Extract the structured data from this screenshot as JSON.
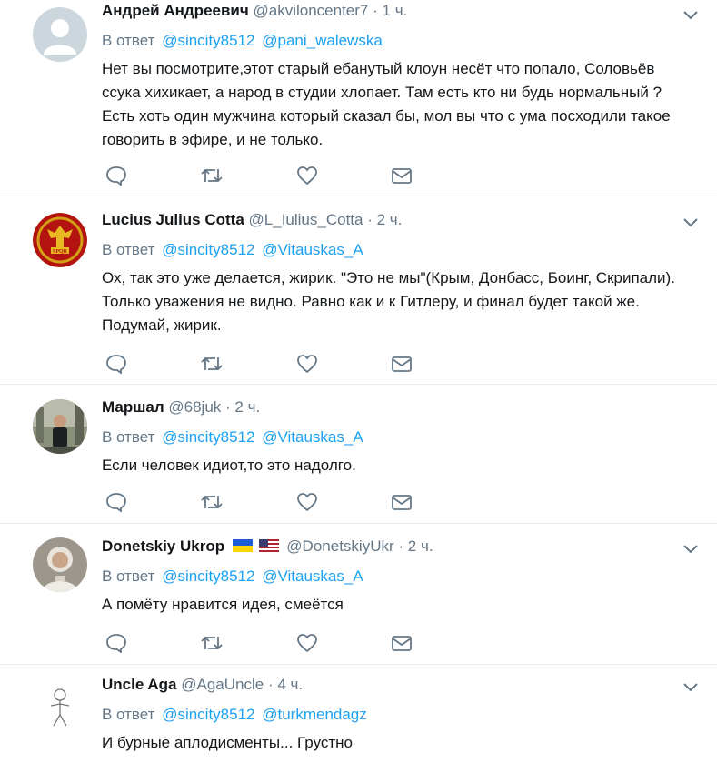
{
  "in_reply_prefix": "В ответ",
  "tweets": [
    {
      "name": "Андрей Андреевич",
      "handle": "@akviloncenter7",
      "dot": "·",
      "time": "1 ч.",
      "mentions": [
        "@sincity8512",
        "@pani_walewska"
      ],
      "text": "Нет вы посмотрите,этот старый ебанутый клоун несёт что попало, Соловьёв ссука хихикает, а народ в  студии хлопает. Там есть кто ни будь нормальный ? Есть хоть один мужчина который сказал бы, мол вы что с ума посходили такое говорить в эфире, и не только."
    },
    {
      "name": "Lucius Julius Cotta",
      "handle": "@L_Iulius_Cotta",
      "dot": "·",
      "time": "2 ч.",
      "mentions": [
        "@sincity8512",
        "@Vitauskas_A"
      ],
      "text": "Ох, так это уже делается, жирик. \"Это не мы\"(Крым, Донбасс, Боинг, Скрипали). Только уважения не видно. Равно как и к Гитлеру, и финал будет такой же. Подумай, жирик.",
      "avatar_text": "SPQR"
    },
    {
      "name": "Маршал",
      "handle": "@68juk",
      "dot": "·",
      "time": "2 ч.",
      "mentions": [
        "@sincity8512",
        "@Vitauskas_A"
      ],
      "text": "Если человек идиот,то это надолго."
    },
    {
      "name": "Donetskiy Ukrop",
      "handle": "@DonetskiyUkr",
      "dot": "·",
      "time": "2 ч.",
      "mentions": [
        "@sincity8512",
        "@Vitauskas_A"
      ],
      "text": "А помёту нравится идея, смеётся"
    },
    {
      "name": "Uncle Aga",
      "handle": "@AgaUncle",
      "dot": "·",
      "time": "4 ч.",
      "mentions": [
        "@sincity8512",
        "@turkmendagz"
      ],
      "text": "И бурные аплодисменты... Грустно"
    }
  ],
  "icons": {
    "reply": "reply-icon",
    "retweet": "retweet-icon",
    "like": "heart-icon",
    "dm": "envelope-icon",
    "menu": "chevron-down-icon"
  },
  "colors": {
    "link": "#1da1f2",
    "secondary": "#657786",
    "divider": "#e6ecf0"
  }
}
